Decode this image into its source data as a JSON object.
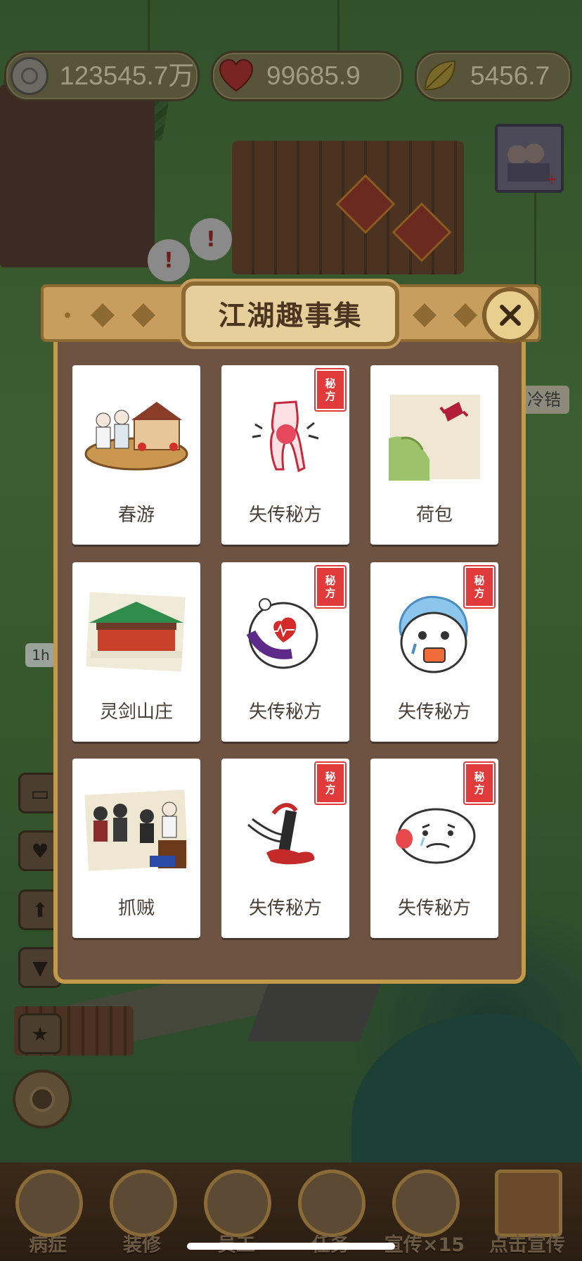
{
  "resources": {
    "coins": "123545.7万",
    "hearts": "99685.9",
    "leaves": "5456.7"
  },
  "modal": {
    "title": "江湖趣事集",
    "close_icon": "close-x-icon",
    "stamp_text": [
      "秘",
      "方"
    ],
    "cards": [
      {
        "label": "春游",
        "art": "spring-outing-boat-icon",
        "secret": false
      },
      {
        "label": "失传秘方",
        "art": "joint-pain-icon",
        "secret": true
      },
      {
        "label": "荷包",
        "art": "purse-candy-icon",
        "secret": false
      },
      {
        "label": "灵剑山庄",
        "art": "temple-building-icon",
        "secret": false
      },
      {
        "label": "失传秘方",
        "art": "heart-ache-dumpling-icon",
        "secret": true
      },
      {
        "label": "失传秘方",
        "art": "feverish-dumpling-icon",
        "secret": true
      },
      {
        "label": "抓贼",
        "art": "catch-thief-group-icon",
        "secret": false
      },
      {
        "label": "失传秘方",
        "art": "bleeding-leg-icon",
        "secret": true
      },
      {
        "label": "失传秘方",
        "art": "sick-dumpling-icon",
        "secret": true
      }
    ]
  },
  "world": {
    "timer_text": "1h",
    "sign_text": "冷锆"
  },
  "bottom_nav": [
    {
      "label": "病症",
      "icon": "book-icon"
    },
    {
      "label": "装修",
      "icon": "paint-brush-icon"
    },
    {
      "label": "员工",
      "icon": "staff-avatar-icon"
    },
    {
      "label": "任务",
      "icon": "task-scroll-icon"
    },
    {
      "label": "宣传×15",
      "icon": "promo-icon"
    },
    {
      "label": "点击宣传",
      "icon": "famous-doctor-banner-icon"
    }
  ],
  "side_buttons": [
    "chest-icon",
    "heart-icon",
    "upgrade-icon",
    "shirt-icon",
    "star-book-icon"
  ],
  "colors": {
    "modal_bg": "#6e5343",
    "modal_border": "#c29a4a",
    "stamp_red": "#e03a3a",
    "card_bg": "#ffffff"
  }
}
